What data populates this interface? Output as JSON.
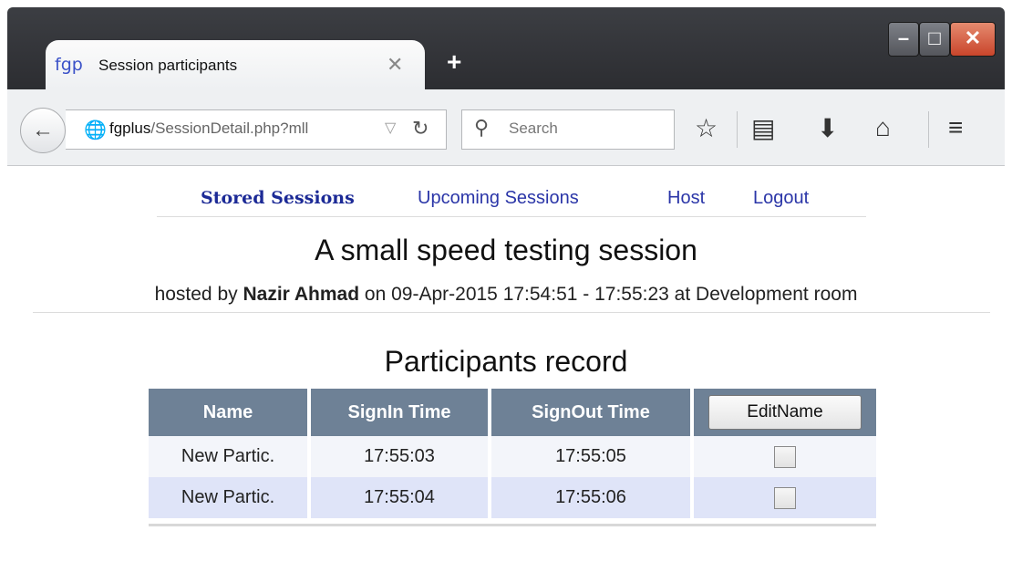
{
  "browser": {
    "tab": {
      "favicon": "fgp",
      "title": "Session participants",
      "close_glyph": "✕"
    },
    "new_tab_glyph": "+",
    "window_controls": {
      "minimize": "–",
      "maximize": "□",
      "close": "✕"
    },
    "url": {
      "host": "fgplus",
      "path": "/SessionDetail.php?mll"
    },
    "search": {
      "placeholder": "Search"
    },
    "icons": [
      "back-icon",
      "globe-icon",
      "reload-icon",
      "search-icon",
      "star-icon",
      "reading-list-icon",
      "download-icon",
      "home-icon",
      "menu-icon"
    ]
  },
  "nav": {
    "items": [
      {
        "label": "Stored Sessions",
        "active": true
      },
      {
        "label": "Upcoming Sessions"
      },
      {
        "label": "Host"
      },
      {
        "label": "Logout"
      }
    ]
  },
  "session": {
    "title": "A small speed testing session",
    "hosted_prefix": "hosted by",
    "host_name": "Nazir Ahmad",
    "hosted_suffix": "on 09-Apr-2015 17:54:51 - 17:55:23 at Development room"
  },
  "participants": {
    "title": "Participants record",
    "columns": [
      "Name",
      "SignIn Time",
      "SignOut Time"
    ],
    "edit_button": "EditName",
    "rows": [
      {
        "name": "New Partic.",
        "signin": "17:55:03",
        "signout": "17:55:05",
        "checked": false
      },
      {
        "name": "New Partic.",
        "signin": "17:55:04",
        "signout": "17:55:06",
        "checked": false
      }
    ]
  },
  "colors": {
    "nav_link": "#2b36a8",
    "table_header": "#6e8196",
    "row_alt": "#dfe4f8"
  }
}
